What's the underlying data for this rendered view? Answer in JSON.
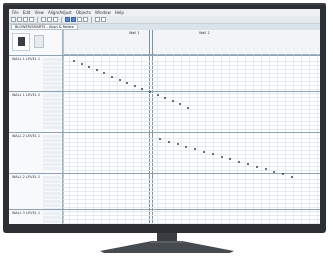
{
  "app": {
    "menu": [
      "File",
      "Edit",
      "View",
      "Align/Adjust",
      "Objects",
      "Window",
      "Help"
    ],
    "doc_tab": "BLOWER/SMARTS - Align & Relate",
    "panels": [
      "Wall 1",
      "Wall 2"
    ]
  },
  "groups": [
    {
      "label": "WALL 1 LEVEL 1"
    },
    {
      "label": "WALL 1 LEVEL 2"
    },
    {
      "label": "WALL 2 LEVEL 1"
    },
    {
      "label": "WALL 2 LEVEL 2"
    },
    {
      "label": "WALL 3 LEVEL 1"
    }
  ],
  "icons": {
    "monitor": "tv-monitor-icon",
    "toolbar": [
      "new-icon",
      "open-icon",
      "save-icon",
      "print-icon",
      "cut-icon",
      "copy-icon",
      "paste-icon",
      "select-icon",
      "zoom-icon",
      "align-icon",
      "relate-icon",
      "grid-icon",
      "settings-icon"
    ]
  },
  "colors": {
    "bezel": "#2c2f33",
    "screen_bg": "#f4f7f9",
    "grid_line": "#e2e9ef",
    "marker": "#33475b",
    "row_label": "#2d4d7a"
  }
}
